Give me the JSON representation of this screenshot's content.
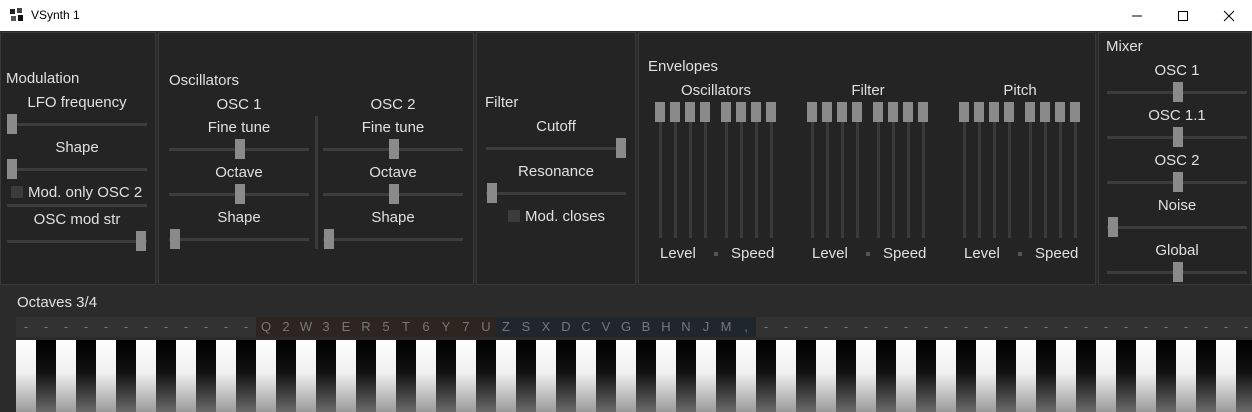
{
  "window": {
    "title": "VSynth 1"
  },
  "modulation": {
    "title": "Modulation",
    "lfo_label": "LFO frequency",
    "shape_label": "Shape",
    "mod_only_label": "Mod. only OSC 2",
    "osc_mod_str_label": "OSC mod str"
  },
  "oscillators": {
    "title": "Oscillators",
    "osc1": {
      "title": "OSC 1",
      "fine_tune": "Fine tune",
      "octave": "Octave",
      "shape": "Shape"
    },
    "osc2": {
      "title": "OSC 2",
      "fine_tune": "Fine tune",
      "octave": "Octave",
      "shape": "Shape"
    }
  },
  "filter": {
    "title": "Filter",
    "cutoff": "Cutoff",
    "resonance": "Resonance",
    "mod_closes": "Mod. closes"
  },
  "envelopes": {
    "title": "Envelopes",
    "groups": [
      {
        "title": "Oscillators",
        "level": "Level",
        "speed": "Speed"
      },
      {
        "title": "Filter",
        "level": "Level",
        "speed": "Speed"
      },
      {
        "title": "Pitch",
        "level": "Level",
        "speed": "Speed"
      }
    ]
  },
  "mixer": {
    "title": "Mixer",
    "channels": [
      "OSC 1",
      "OSC 1.1",
      "OSC 2",
      "Noise",
      "Global"
    ]
  },
  "keyboard": {
    "octaves_label": "Octaves 3/4",
    "keymap": [
      "-",
      "-",
      "-",
      "-",
      "-",
      "-",
      "-",
      "-",
      "-",
      "-",
      "-",
      "-",
      "Q",
      "2",
      "W",
      "3",
      "E",
      "R",
      "5",
      "T",
      "6",
      "Y",
      "7",
      "U",
      "Z",
      "S",
      "X",
      "D",
      "C",
      "V",
      "G",
      "B",
      "H",
      "N",
      "J",
      "M",
      ",",
      "-",
      "-",
      "-",
      "-",
      "-",
      "-",
      "-",
      "-",
      "-",
      "-",
      "-",
      "-",
      "-",
      "-",
      "-",
      "-",
      "-",
      "-",
      "-",
      "-",
      "-",
      "-",
      "-",
      "-",
      "-"
    ]
  },
  "colors": {
    "background": "#2b2b2b",
    "panel": "#242424",
    "thumb": "#8a8a8a",
    "text": "#e0e0e0"
  }
}
